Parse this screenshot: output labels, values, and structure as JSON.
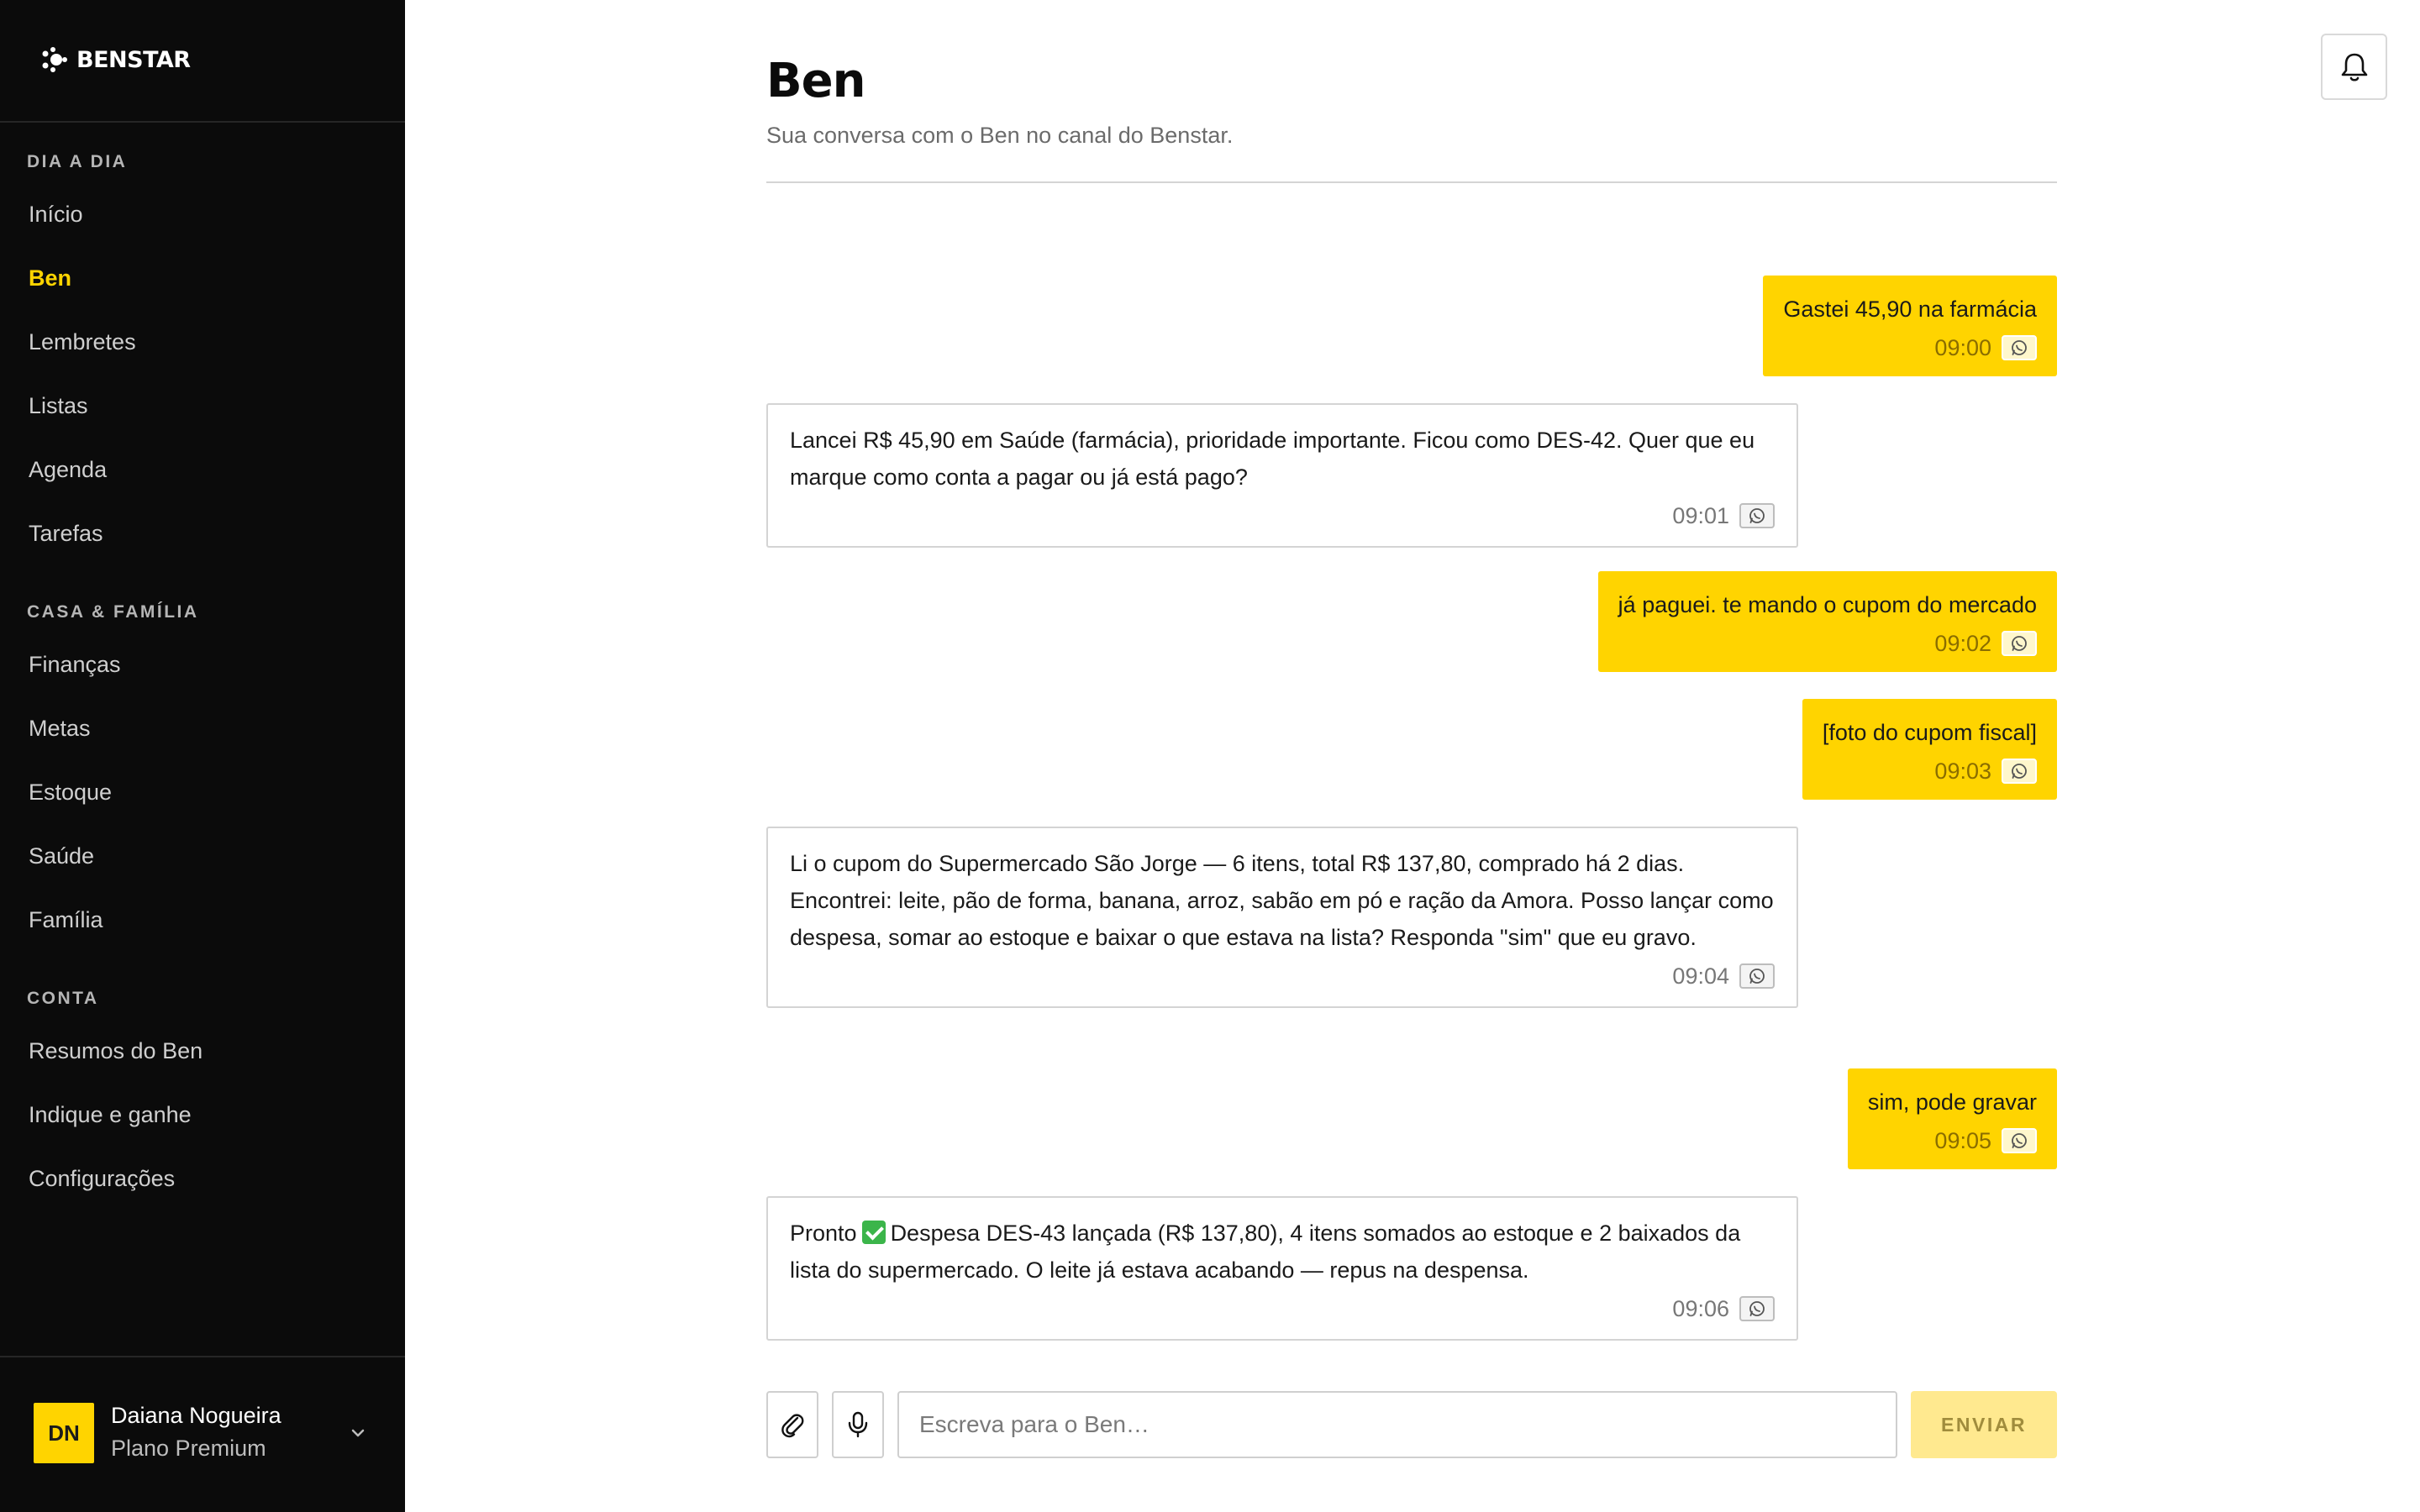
{
  "brand": {
    "name": "BENSTAR"
  },
  "sidebar": {
    "sections": [
      {
        "title": "DIA A DIA",
        "items": [
          "Início",
          "Ben",
          "Lembretes",
          "Listas",
          "Agenda",
          "Tarefas"
        ]
      },
      {
        "title": "CASA & FAMÍLIA",
        "items": [
          "Finanças",
          "Metas",
          "Estoque",
          "Saúde",
          "Família"
        ]
      },
      {
        "title": "CONTA",
        "items": [
          "Resumos do Ben",
          "Indique e ganhe",
          "Configurações"
        ]
      }
    ],
    "active_item": "Ben",
    "user": {
      "initials": "DN",
      "name": "Daiana Nogueira",
      "plan": "Plano Premium"
    }
  },
  "header": {
    "title": "Ben",
    "subtitle": "Sua conversa com o Ben no canal do Benstar."
  },
  "messages": [
    {
      "from": "user",
      "text": "Gastei 45,90 na farmácia",
      "time": "09:00",
      "channel_icon": "whatsapp-icon"
    },
    {
      "from": "ben",
      "text": "Lancei R$ 45,90 em Saúde (farmácia), prioridade importante. Ficou como DES-42. Quer que eu marque como conta a pagar ou já está pago?",
      "time": "09:01",
      "channel_icon": "whatsapp-icon"
    },
    {
      "from": "user",
      "text": "já paguei. te mando o cupom do mercado",
      "time": "09:02",
      "channel_icon": "whatsapp-icon"
    },
    {
      "from": "user",
      "text": "[foto do cupom fiscal]",
      "time": "09:03",
      "channel_icon": "whatsapp-icon"
    },
    {
      "from": "ben",
      "text": "Li o cupom do Supermercado São Jorge — 6 itens, total R$ 137,80, comprado há 2 dias. Encontrei: leite, pão de forma, banana, arroz, sabão em pó e ração da Amora. Posso lançar como despesa, somar ao estoque e baixar o que estava na lista? Responda \"sim\" que eu gravo.",
      "time": "09:04",
      "channel_icon": "whatsapp-icon"
    },
    {
      "from": "user",
      "text": "sim, pode gravar",
      "time": "09:05",
      "channel_icon": "whatsapp-icon"
    },
    {
      "from": "ben",
      "text_before": "Pronto",
      "text_after": "Despesa DES-43 lançada (R$ 137,80), 4 itens somados ao estoque e 2 baixados da lista do supermercado. O leite já estava acabando — repus na despensa.",
      "time": "09:06",
      "channel_icon": "whatsapp-icon"
    }
  ],
  "composer": {
    "placeholder": "Escreva para o Ben…",
    "send_label": "ENVIAR"
  },
  "colors": {
    "accent": "#ffd400",
    "sidebar_bg": "#0b0b0b",
    "send_disabled": "#ffe98f"
  }
}
